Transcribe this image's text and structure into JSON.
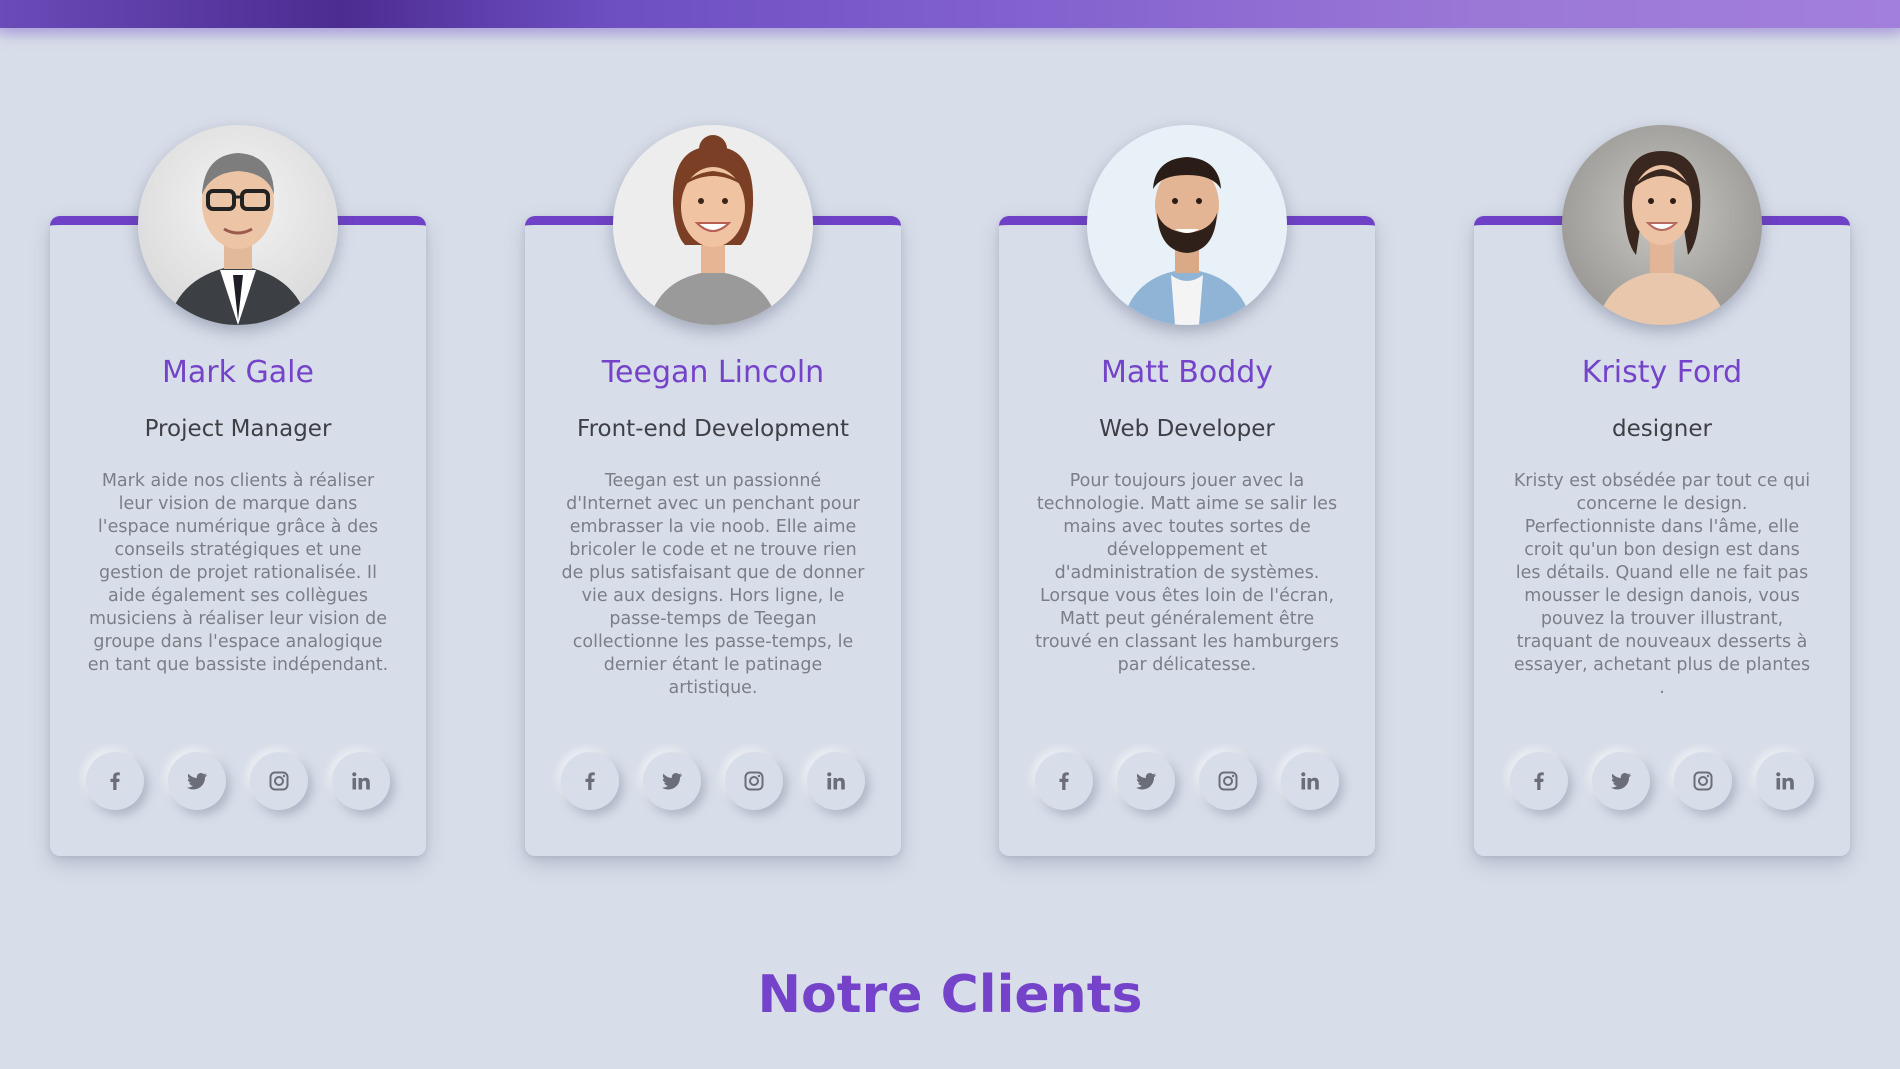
{
  "colors": {
    "accent": "#7443c9",
    "background": "#d8dee9",
    "banner": "#8462cf"
  },
  "team": [
    {
      "name": "Mark Gale",
      "role": "Project Manager",
      "bio": "Mark aide nos clients à réaliser leur vision de marque dans l'espace numérique grâce à des conseils stratégiques et une gestion de projet rationalisée. Il aide également ses collègues musiciens à réaliser leur vision de groupe dans l'espace analogique en tant que bassiste indépendant.",
      "socials": [
        "facebook-icon",
        "twitter-icon",
        "instagram-icon",
        "linkedin-icon"
      ]
    },
    {
      "name": "Teegan Lincoln",
      "role": "Front-end Development",
      "bio": "Teegan est un passionné d'Internet avec un penchant pour embrasser la vie noob. Elle aime bricoler le code et ne trouve rien de plus satisfaisant que de donner vie aux designs. Hors ligne, le passe-temps de Teegan collectionne les passe-temps, le dernier étant le patinage artistique.",
      "socials": [
        "facebook-icon",
        "twitter-icon",
        "instagram-icon",
        "linkedin-icon"
      ]
    },
    {
      "name": "Matt Boddy",
      "role": "Web Developer",
      "bio": "Pour toujours jouer avec la technologie. Matt aime se salir les mains avec toutes sortes de développement et d'administration de systèmes. Lorsque vous êtes loin de l'écran, Matt peut généralement être trouvé en classant les hamburgers par délicatesse.",
      "socials": [
        "facebook-icon",
        "twitter-icon",
        "instagram-icon",
        "linkedin-icon"
      ]
    },
    {
      "name": "Kristy Ford",
      "role": "designer",
      "bio": "Kristy est obsédée par tout ce qui concerne le design. Perfectionniste dans l'âme, elle croit qu'un bon design est dans les détails. Quand elle ne fait pas mousser le design danois, vous pouvez la trouver illustrant, traquant de nouveaux desserts à essayer, achetant plus de plantes .",
      "socials": [
        "facebook-icon",
        "twitter-icon",
        "instagram-icon",
        "linkedin-icon"
      ]
    }
  ],
  "clients_section": {
    "title": "Notre Clients"
  }
}
